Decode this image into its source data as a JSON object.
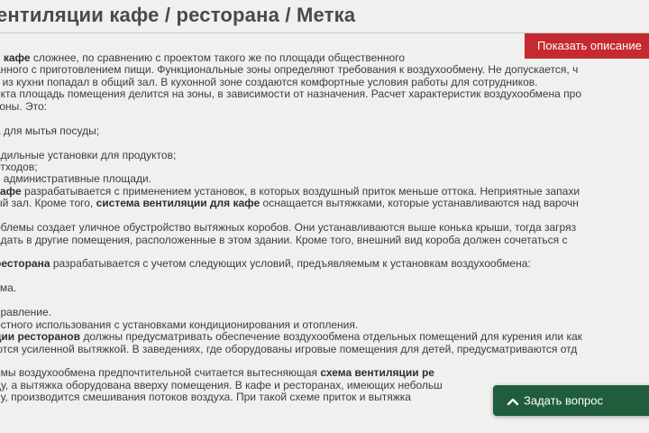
{
  "header": {
    "title": "ентиляции кафе / ресторана  /  Метка"
  },
  "actions": {
    "show_description": "Показать описание",
    "ask_question": "Задать вопрос",
    "ask_icon": "chevron-up-icon"
  },
  "colors": {
    "accent_red": "#c42a2f",
    "ask_green": "#1f5d3d",
    "background": "#f0f0ee"
  },
  "content": {
    "lines": [
      [
        {
          "t": "я "
        },
        {
          "t": "кафе",
          "b": true
        },
        {
          "t": " сложнее, по сравнению с проектом такого же по площади общественного"
        }
      ],
      [
        {
          "t": "анного с приготовлением пищи. Функциональные зоны определяют требования к воздухообмену. Не допускается, ч"
        }
      ],
      [
        {
          "t": "к из кухни попадал в общий зал. В кухонной зоне создаются комфортные условия работы для сотрудников."
        }
      ],
      [
        {
          "t": "екта площадь помещения делится на зоны, в зависимости от назначения. Расчет характеристик воздухообмена про"
        }
      ],
      [
        {
          "t": "зоны. Это:"
        }
      ],
      [
        {
          "t": ""
        }
      ],
      [
        {
          "t": "а для мытья посуды;"
        }
      ],
      [
        {
          "t": ""
        }
      ],
      [
        {
          "t": "адильные установки для продуктов;"
        }
      ],
      [
        {
          "t": "отходов;"
        }
      ],
      [
        {
          "t": "в административные площади."
        }
      ],
      [
        {
          "t": "кафе",
          "b": true
        },
        {
          "t": " разрабатывается с применением установок, в которых воздушный приток меньше оттока. Неприятные запахи"
        }
      ],
      [
        {
          "t": "ый зал. Кроме того, "
        },
        {
          "t": "система вентиляции для кафе",
          "b": true
        },
        {
          "t": " оснащается вытяжками, которые устанавливаются над варочн"
        }
      ],
      [
        {
          "t": ""
        }
      ],
      [
        {
          "t": "облемы создает уличное обустройство вытяжных коробов. Они устанавливаются выше конька крыши, тогда загряз"
        }
      ],
      [
        {
          "t": "адать в другие помещения, расположенные в этом здании. Кроме того, внешний вид короба должен сочетаться с"
        }
      ],
      [
        {
          "t": ""
        }
      ],
      [
        {
          "t": " ресторана",
          "b": true
        },
        {
          "t": " разрабатывается с учетом следующих условий, предъявляемым к установкам воздухообмена:"
        }
      ],
      [
        {
          "t": ""
        }
      ],
      [
        {
          "t": "ума."
        }
      ],
      [
        {
          "t": ""
        }
      ],
      [
        {
          "t": "правление."
        }
      ],
      [
        {
          "t": "естного использования с установками кондиционирования и отопления."
        }
      ],
      [
        {
          "t": "ции ресторанов",
          "b": true
        },
        {
          "t": " должны предусматривать обеспечение воздухообмена отдельных помещений для курения или как"
        }
      ],
      [
        {
          "t": "ются усиленной вытяжкой. В заведениях, где оборудованы игровые помещения для детей, предусматриваются отд"
        }
      ],
      [
        {
          "t": ""
        }
      ],
      [
        {
          "t": "емы воздухообмена предпочтительной считается вытесняющая "
        },
        {
          "t": "схема вентиляции ре",
          "b": true
        }
      ],
      [
        {
          "t": "ду, а вытяжка оборудована вверху помещения. В кафе и ресторанах, имеющих небольш"
        }
      ],
      [
        {
          "t": "ну, производится смешивания потоков воздуха. При такой схеме приток и вытяжка"
        }
      ]
    ]
  }
}
